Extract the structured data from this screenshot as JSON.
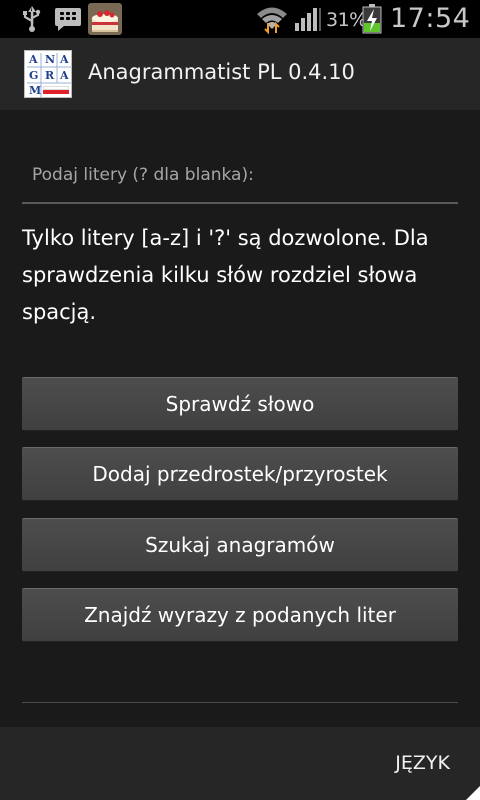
{
  "status_bar": {
    "battery_percent": "31%",
    "time": "17:54",
    "icons": [
      "usb-icon",
      "bbm-icon",
      "cake-app-icon",
      "wifi-icon",
      "signal-icon",
      "battery-charging-icon"
    ]
  },
  "action_bar": {
    "logo_letters": [
      "A",
      "N",
      "A",
      "G",
      "R",
      "A",
      "M"
    ],
    "title": "Anagrammatist PL 0.4.10"
  },
  "input": {
    "placeholder": "Podaj litery (? dla blanka):",
    "value": ""
  },
  "info_text": "Tylko litery [a-z] i '?' są dozwolone. Dla sprawdzenia kilku słów rozdziel słowa spacją.",
  "buttons": {
    "check_word": "Sprawdź słowo",
    "add_affix": "Dodaj przedrostek/przyrostek",
    "search_anagrams": "Szukaj anagramów",
    "find_words": "Znajdź wyrazy z podanych liter"
  },
  "bottom_bar": {
    "language": "JĘZYK"
  },
  "colors": {
    "background": "#1a1a1a",
    "action_bar": "#262626",
    "button": "#464646",
    "logo_text": "#1f3f8f",
    "flag_red": "#e0202a",
    "battery_green": "#5fc52e",
    "wifi_arrow": "#f0a020"
  }
}
